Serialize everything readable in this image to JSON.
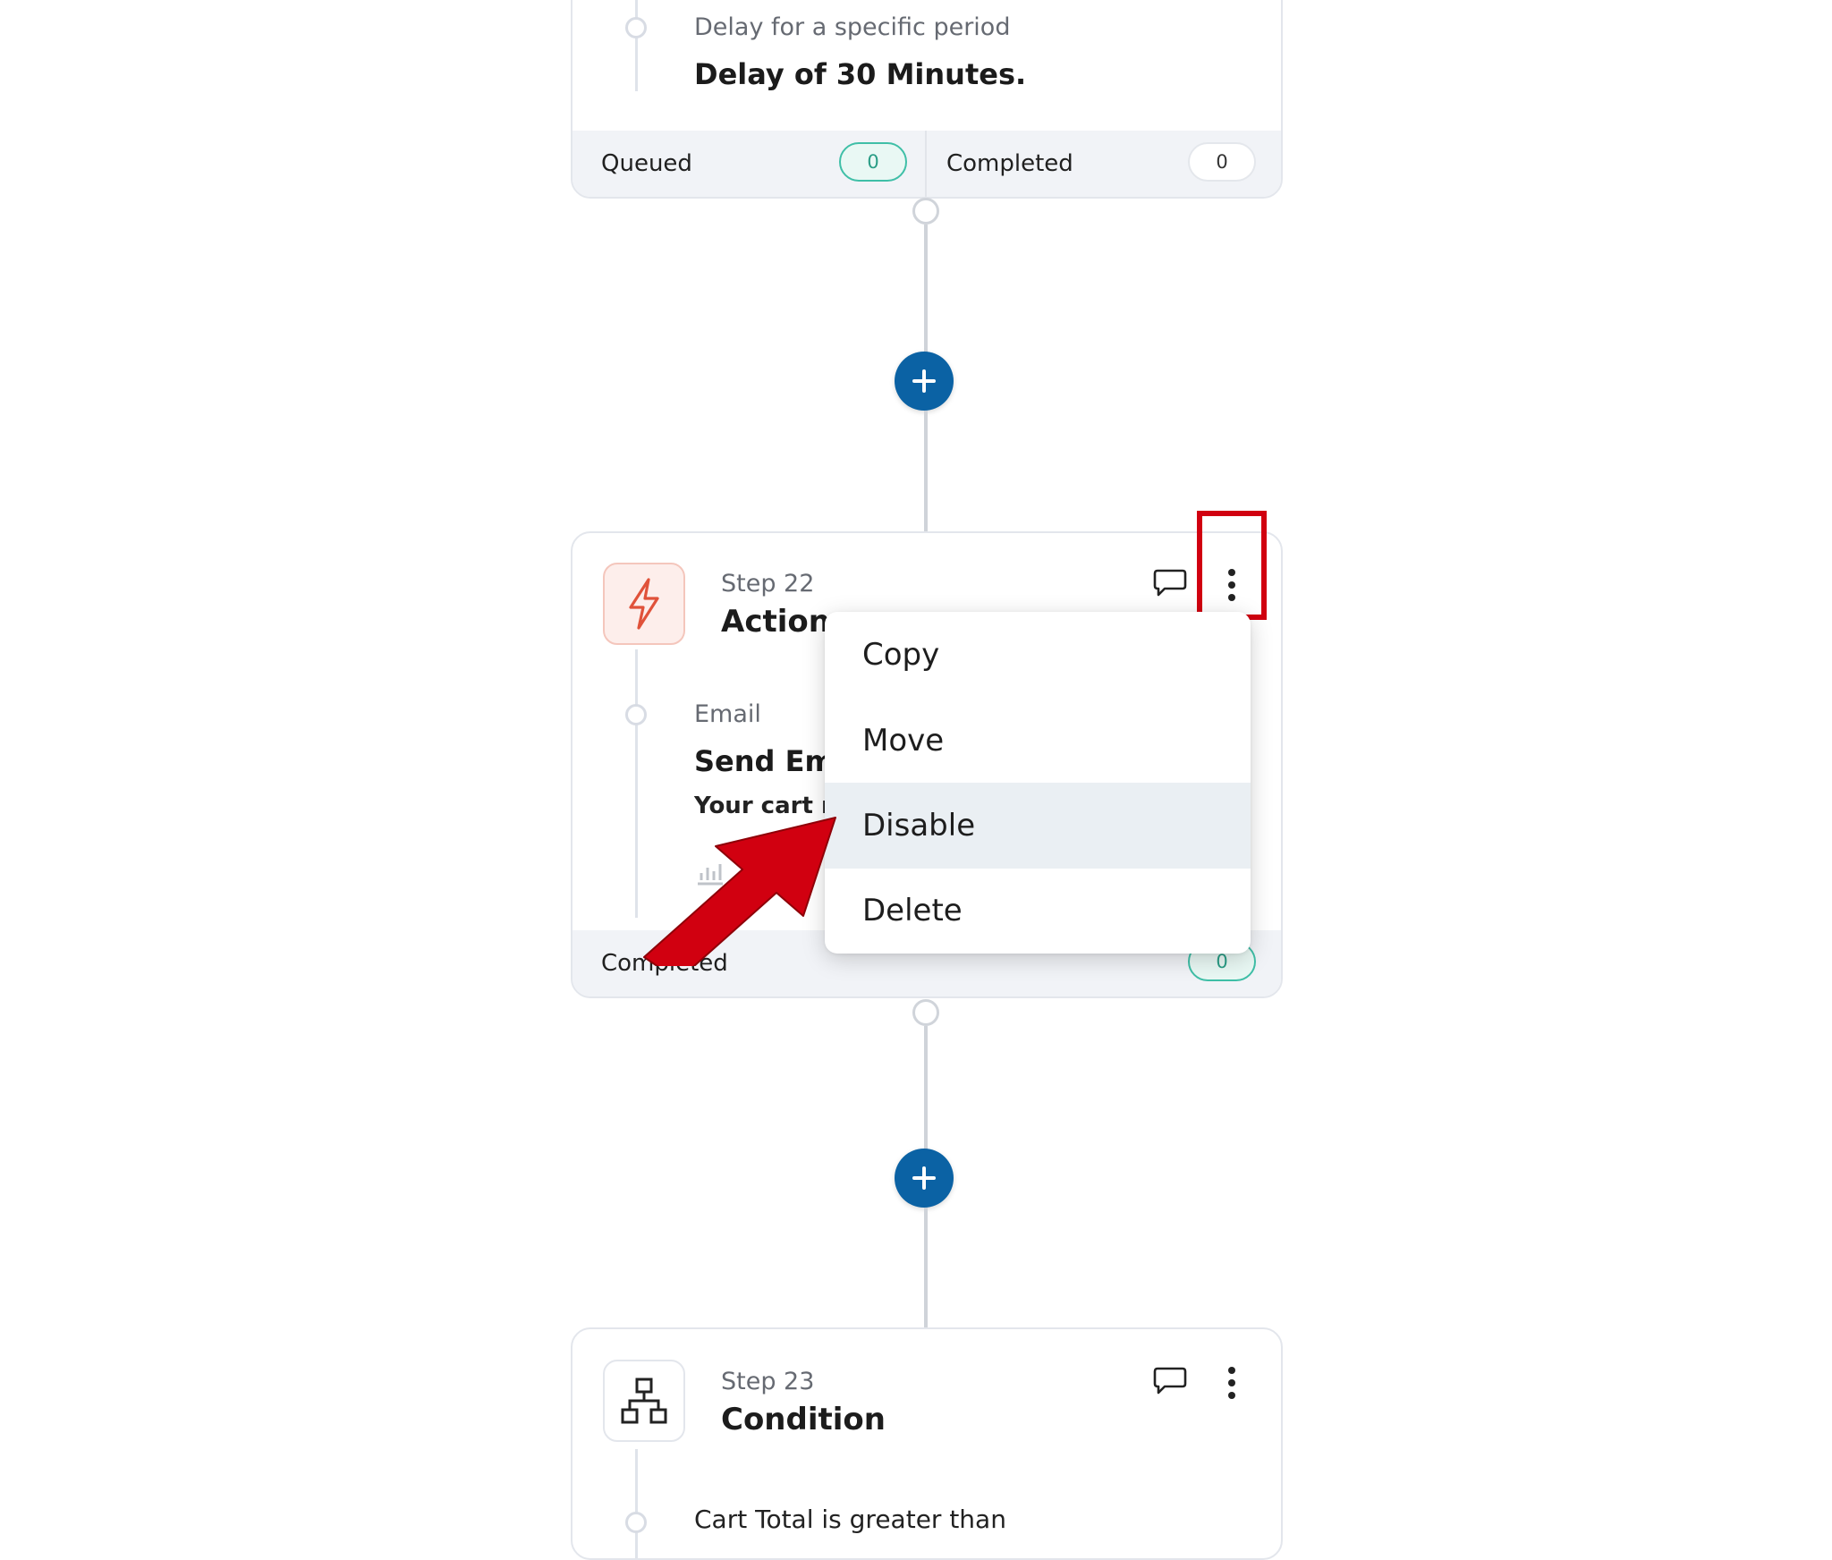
{
  "card_top": {
    "detail_type": "Delay for a specific period",
    "detail_title": "Delay of 30 Minutes.",
    "footer": {
      "queued_label": "Queued",
      "queued_count": "0",
      "completed_label": "Completed",
      "completed_count": "0"
    }
  },
  "step22": {
    "step_label": "Step 22",
    "title": "Action",
    "detail_type": "Email",
    "detail_title": "Send Ema",
    "detail_text": "Your cart m",
    "footer": {
      "completed_label": "Completed",
      "completed_count": "0"
    }
  },
  "context_menu": {
    "items": [
      {
        "label": "Copy"
      },
      {
        "label": "Move"
      },
      {
        "label": "Disable"
      },
      {
        "label": "Delete"
      }
    ],
    "hovered": "Disable"
  },
  "step23": {
    "step_label": "Step 23",
    "title": "Condition",
    "detail_text": "Cart Total is greater than"
  },
  "icons": {
    "action": "lightning-icon",
    "condition": "hierarchy-icon",
    "comment": "comment-icon",
    "more": "more-vertical-icon",
    "add": "plus-icon"
  },
  "colors": {
    "add_button": "#0b62a4",
    "teal_pill": "#3fbfa7",
    "action_icon": "#e0523a",
    "highlight_box": "#d10010",
    "annotation_arrow": "#d10010"
  }
}
